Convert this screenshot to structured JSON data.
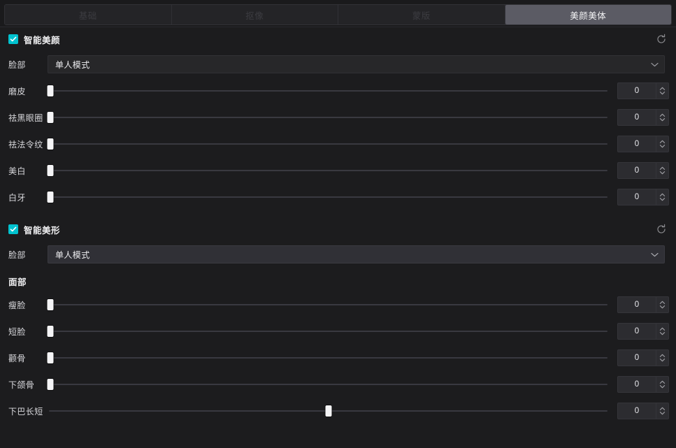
{
  "tabs": [
    {
      "label": "基础",
      "active": false
    },
    {
      "label": "抠像",
      "active": false
    },
    {
      "label": "蒙版",
      "active": false
    },
    {
      "label": "美颜美体",
      "active": true
    }
  ],
  "colors": {
    "accent": "#00c2cf",
    "active_tab_bg": "#5b5b64",
    "panel_bg": "#1c1c1e",
    "handle": "#f4f4f6",
    "track": "#393940"
  },
  "sections": [
    {
      "title": "智能美颜",
      "checked": true,
      "reset_icon": "reset-icon",
      "mode_row": {
        "label": "脸部",
        "value": "单人模式",
        "chevron_icon": "chevron-down-icon",
        "highlighted": false
      },
      "sliders": [
        {
          "label": "磨皮",
          "value": "0",
          "percent": 0
        },
        {
          "label": "祛黑眼圈",
          "value": "0",
          "percent": 0
        },
        {
          "label": "祛法令纹",
          "value": "0",
          "percent": 0
        },
        {
          "label": "美白",
          "value": "0",
          "percent": 0
        },
        {
          "label": "白牙",
          "value": "0",
          "percent": 0
        }
      ]
    },
    {
      "title": "智能美形",
      "checked": true,
      "reset_icon": "reset-icon",
      "mode_row": {
        "label": "脸部",
        "value": "单人模式",
        "chevron_icon": "chevron-down-icon",
        "highlighted": true
      },
      "subhead": "面部",
      "sliders": [
        {
          "label": "瘦脸",
          "value": "0",
          "percent": 0
        },
        {
          "label": "短脸",
          "value": "0",
          "percent": 0
        },
        {
          "label": "颧骨",
          "value": "0",
          "percent": 0
        },
        {
          "label": "下颌骨",
          "value": "0",
          "percent": 0
        },
        {
          "label": "下巴长短",
          "value": "0",
          "percent": 50
        }
      ]
    }
  ]
}
